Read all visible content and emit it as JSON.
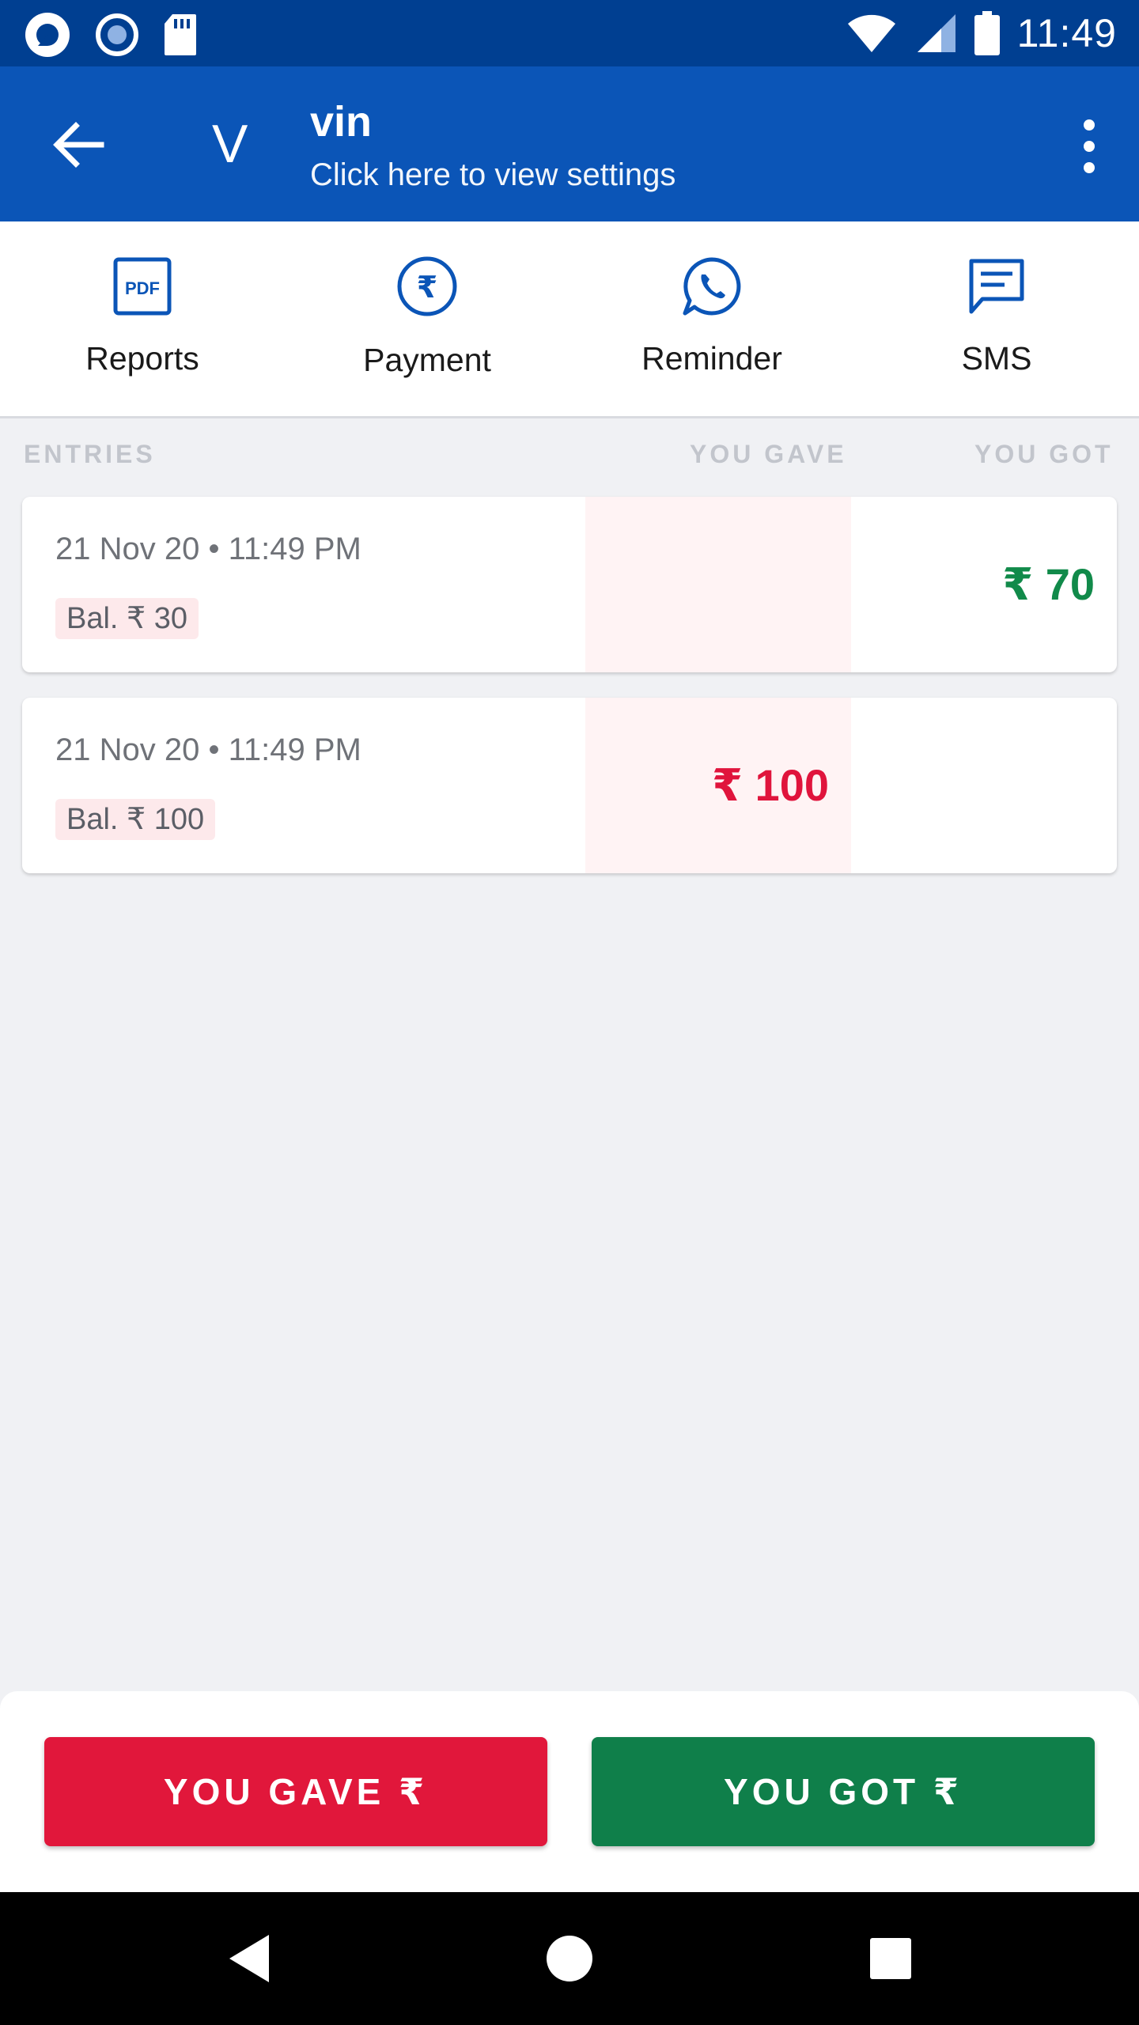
{
  "status_bar": {
    "time": "11:49",
    "left_icons": [
      "app-notification-icon",
      "record-icon",
      "sd-card-icon"
    ],
    "right_icons": [
      "wifi-icon",
      "cell-signal-icon",
      "battery-icon"
    ]
  },
  "header": {
    "avatar_letter": "V",
    "name": "vin",
    "subtitle": "Click here to view settings",
    "color": "#0b55b7"
  },
  "actions": [
    {
      "label": "Reports",
      "icon": "pdf-icon"
    },
    {
      "label": "Payment",
      "icon": "rupee-circle-icon"
    },
    {
      "label": "Reminder",
      "icon": "whatsapp-icon"
    },
    {
      "label": "SMS",
      "icon": "message-icon"
    }
  ],
  "columns": {
    "entries": "ENTRIES",
    "you_gave": "YOU GAVE",
    "you_got": "YOU GOT"
  },
  "entries": [
    {
      "datetime": "21 Nov 20 • 11:49 PM",
      "balance": "Bal. ₹ 30",
      "gave": "",
      "got": "₹ 70"
    },
    {
      "datetime": "21 Nov 20 • 11:49 PM",
      "balance": "Bal. ₹ 100",
      "gave": "₹ 100",
      "got": ""
    }
  ],
  "buttons": {
    "you_gave": "YOU GAVE ₹",
    "you_got": "YOU GOT ₹"
  },
  "colors": {
    "gave": "#e1173b",
    "got": "#0f7f4a",
    "status_bar": "#003f91"
  },
  "nav_bar": [
    "back-triangle-icon",
    "home-circle-icon",
    "recents-square-icon"
  ]
}
